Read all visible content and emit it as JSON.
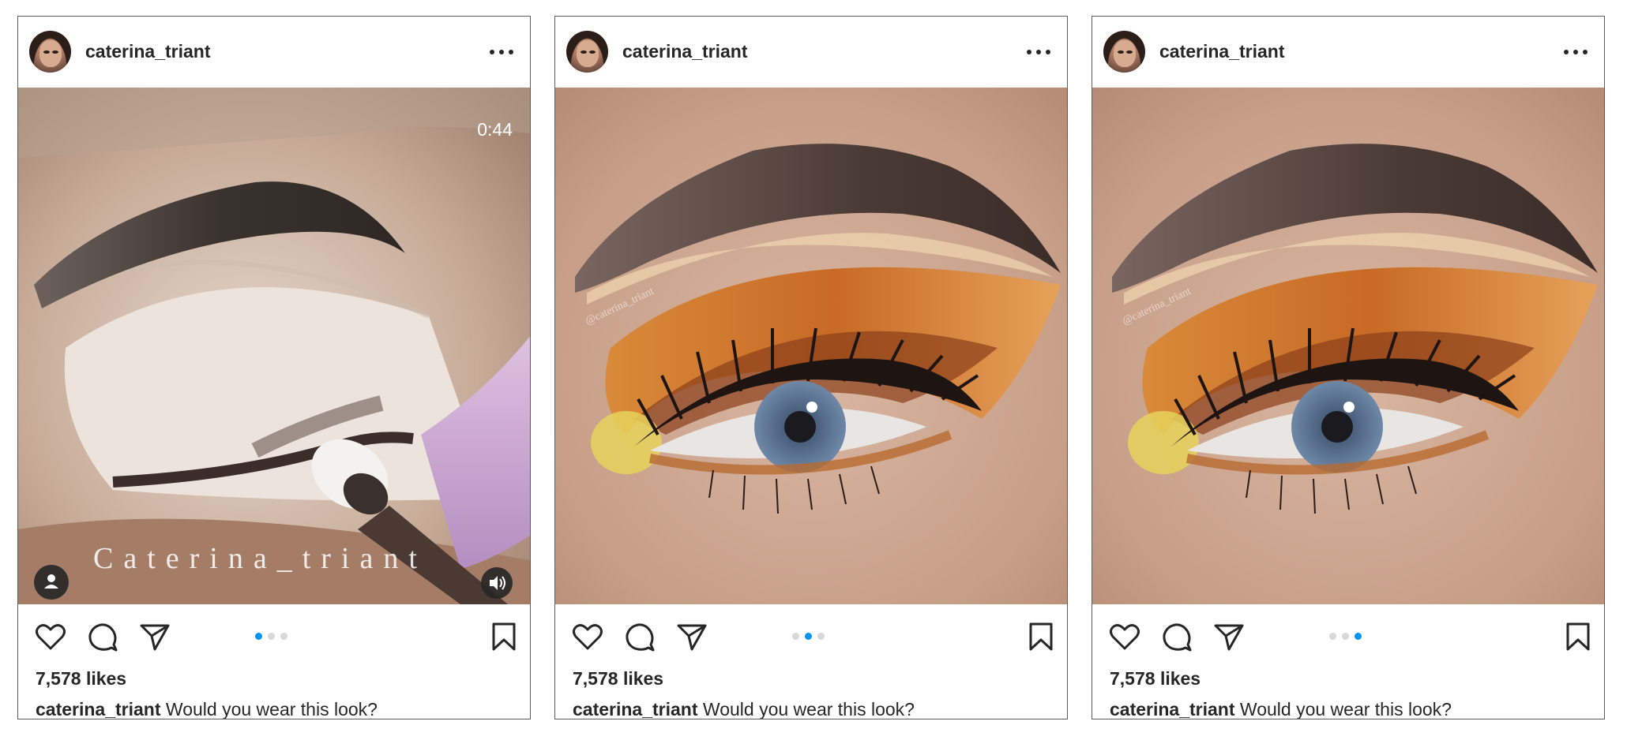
{
  "posts": [
    {
      "username": "caterina_triant",
      "media_type": "video",
      "duration": "0:44",
      "watermark": "Caterina_triant",
      "likes": "7,578 likes",
      "caption_user": "caterina_triant",
      "caption_text": "Would you wear this look?",
      "carousel_active_index": 0,
      "carousel_count": 3
    },
    {
      "username": "caterina_triant",
      "media_type": "image",
      "watermark": "@caterina_triant",
      "likes": "7,578 likes",
      "caption_user": "caterina_triant",
      "caption_text": "Would you wear this look?",
      "carousel_active_index": 1,
      "carousel_count": 3
    },
    {
      "username": "caterina_triant",
      "media_type": "image",
      "watermark": "@caterina_triant",
      "likes": "7,578 likes",
      "caption_user": "caterina_triant",
      "caption_text": "Would you wear this look?",
      "carousel_active_index": 2,
      "carousel_count": 3
    }
  ],
  "icons": {
    "avatar": "avatar",
    "more": "more-horizontal-icon",
    "like": "heart-icon",
    "comment": "comment-icon",
    "share": "paper-plane-icon",
    "save": "bookmark-icon",
    "user_tags": "user-tag-icon",
    "sound": "speaker-icon"
  },
  "colors": {
    "accent": "#0095f6",
    "text": "#262626",
    "dot_inactive": "#d8d8d8"
  }
}
